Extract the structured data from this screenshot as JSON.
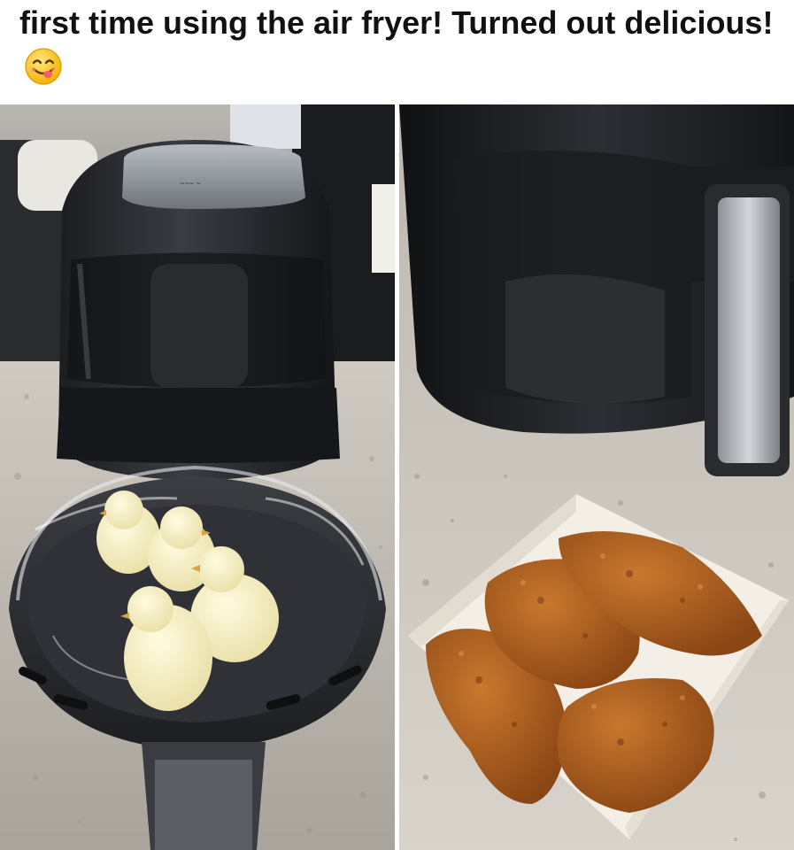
{
  "post": {
    "caption": "first time using the air fryer! Turned out delicious!",
    "emoji": "savoring-food-face-emoji"
  },
  "panels": [
    {
      "scene": "air-fryer-with-chicks"
    },
    {
      "scene": "air-fryer-with-fried-chicken"
    }
  ]
}
